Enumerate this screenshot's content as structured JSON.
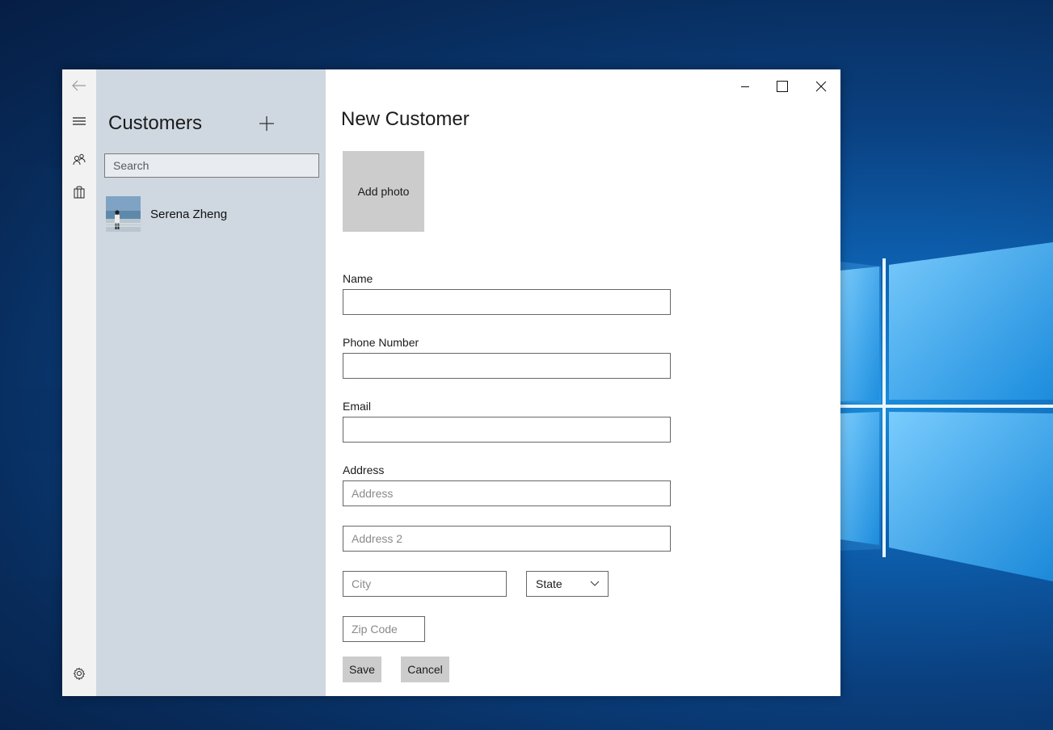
{
  "nav": {
    "back_icon": "arrow-left-icon",
    "menu_icon": "hamburger-icon",
    "customers_icon": "people-icon",
    "orders_icon": "shopping-bag-icon",
    "settings_icon": "gear-icon"
  },
  "list": {
    "title": "Customers",
    "search_placeholder": "Search",
    "customers": [
      {
        "name": "Serena Zheng"
      }
    ]
  },
  "form": {
    "title": "New Customer",
    "photo_label": "Add photo",
    "name_label": "Name",
    "phone_label": "Phone Number",
    "email_label": "Email",
    "address_label": "Address",
    "address_placeholder": "Address",
    "address2_placeholder": "Address 2",
    "city_placeholder": "City",
    "state_value": "State",
    "zip_placeholder": "Zip Code",
    "save_label": "Save",
    "cancel_label": "Cancel"
  },
  "colors": {
    "rail_bg": "#f2f2f2",
    "list_bg": "#cfd8e1",
    "photo_bg": "#cccccc"
  }
}
